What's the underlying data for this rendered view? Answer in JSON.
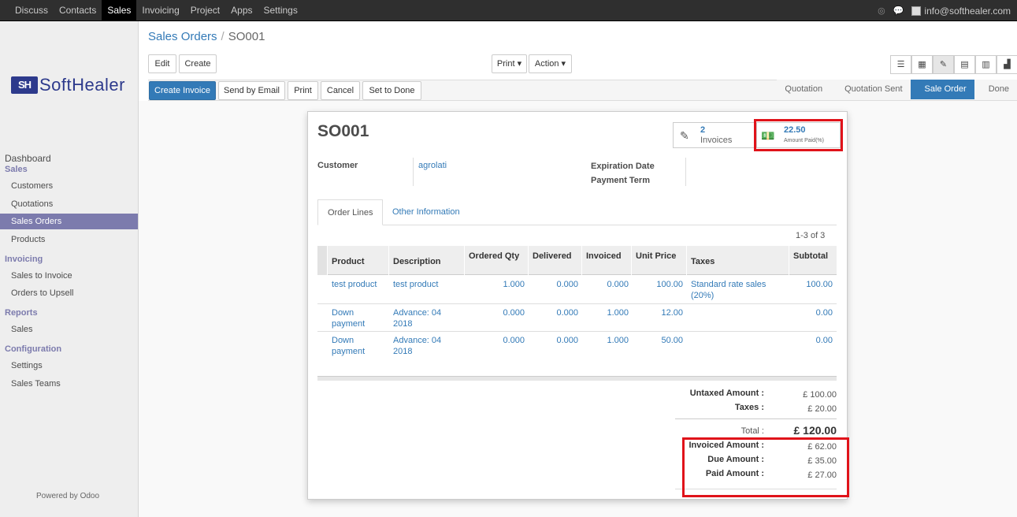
{
  "topnav": {
    "items": [
      "Discuss",
      "Contacts",
      "Sales",
      "Invoicing",
      "Project",
      "Apps",
      "Settings"
    ],
    "active": "Sales"
  },
  "user": {
    "email": "info@softhealer.com"
  },
  "logo": {
    "mark": "SH",
    "word": "SoftHealer"
  },
  "sidebar": {
    "sections": [
      {
        "label": "Dashboard"
      },
      {
        "label": "Sales",
        "items": [
          "Customers",
          "Quotations",
          "Sales Orders",
          "Products"
        ]
      },
      {
        "label": "Invoicing",
        "items": [
          "Sales to Invoice",
          "Orders to Upsell"
        ]
      },
      {
        "label": "Reports",
        "items": [
          "Sales"
        ]
      },
      {
        "label": "Configuration",
        "items": [
          "Settings",
          "Sales Teams"
        ]
      }
    ],
    "active_item": "Sales Orders",
    "powered": "Powered by Odoo"
  },
  "breadcrumb": {
    "parent": "Sales Orders",
    "separator": "/",
    "current": "SO001"
  },
  "buttons": {
    "edit": "Edit",
    "create": "Create",
    "print": "Print ▾",
    "action": "Action ▾",
    "create_invoice": "Create Invoice",
    "send_email": "Send by Email",
    "print2": "Print",
    "cancel": "Cancel",
    "set_done": "Set to Done"
  },
  "stages": [
    "Quotation",
    "Quotation Sent",
    "Sale Order",
    "Done"
  ],
  "active_stage": "Sale Order",
  "record": {
    "name": "SO001",
    "invoices": {
      "count": "2",
      "label": "Invoices"
    },
    "amount_paid": {
      "value": "22.50",
      "label": "Amount Paid(%)"
    },
    "customer_label": "Customer",
    "customer": "agrolati",
    "expiration_label": "Expiration Date",
    "payment_term_label": "Payment Term"
  },
  "tabs": [
    "Order Lines",
    "Other Information"
  ],
  "pager": "1-3 of 3",
  "table": {
    "headers": [
      "Product",
      "Description",
      "Ordered Qty",
      "Delivered",
      "Invoiced",
      "Unit Price",
      "Taxes",
      "Subtotal"
    ],
    "rows": [
      {
        "product": "test product",
        "description": "test product",
        "ordered": "1.000",
        "delivered": "0.000",
        "invoiced": "0.000",
        "price": "100.00",
        "taxes": "Standard rate sales (20%)",
        "subtotal": "100.00"
      },
      {
        "product": "Down payment",
        "description": "Advance: 04 2018",
        "ordered": "0.000",
        "delivered": "0.000",
        "invoiced": "1.000",
        "price": "12.00",
        "taxes": "",
        "subtotal": "0.00"
      },
      {
        "product": "Down payment",
        "description": "Advance: 04 2018",
        "ordered": "0.000",
        "delivered": "0.000",
        "invoiced": "1.000",
        "price": "50.00",
        "taxes": "",
        "subtotal": "0.00"
      }
    ]
  },
  "totals": {
    "untaxed_label": "Untaxed Amount :",
    "untaxed": "£ 100.00",
    "taxes_label": "Taxes :",
    "taxes": "£ 20.00",
    "total_label": "Total :",
    "total": "£ 120.00",
    "invoiced_label": "Invoiced Amount :",
    "invoiced": "£ 62.00",
    "due_label": "Due Amount :",
    "due": "£ 35.00",
    "paid_label": "Paid Amount :",
    "paid": "£ 27.00"
  },
  "colors": {
    "highlight_box": "#e0131a",
    "link": "#337ab7",
    "sidebar_active": "#7c7bad"
  }
}
